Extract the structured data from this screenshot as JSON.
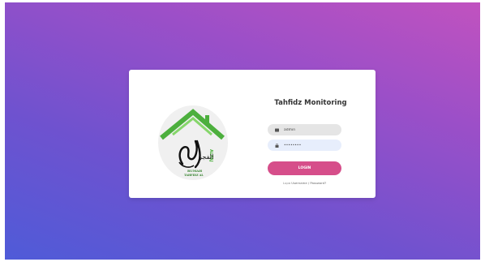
{
  "app": {
    "title": "Tahfidz Monitoring"
  },
  "logo": {
    "icon": "house-calligraphy-logo",
    "side_text": "ALFAJ",
    "bottom_line1": "RUMAH",
    "bottom_line2": "TAHFIDZ AL",
    "calligraphy": "الفجر"
  },
  "login": {
    "username_value": "admin",
    "password_value": "••••••••",
    "button_label": "LOGIN",
    "forgot_prefix": "Lupa",
    "forgot_link": "Username / Password?"
  },
  "colors": {
    "gradient_start": "#4f5bd8",
    "gradient_end": "#c152bf",
    "button": "#d64e8a",
    "logo_green": "#4caf3d"
  }
}
